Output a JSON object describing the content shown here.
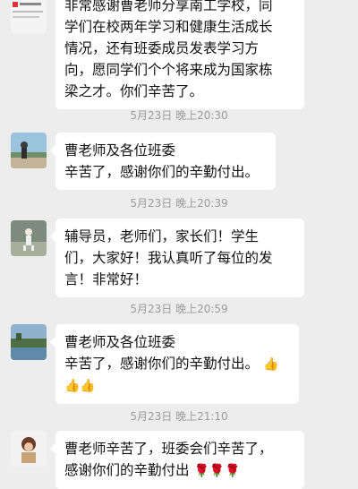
{
  "messages": [
    {
      "lines": [
        "非常感谢曹老师分享南工学校，同",
        "学们在校两年学习和健康生活成长",
        "情况，还有班委成员发表学习方",
        "向，愿同学们个个将来成为国家栋",
        "梁之才。你们辛苦了。"
      ]
    },
    {
      "timestamp": "5月23日 晚上20:30",
      "lines": [
        "曹老师及各位班委",
        "辛苦了，感谢你们的辛勤付出。"
      ]
    },
    {
      "timestamp": "5月23日 晚上20:39",
      "lines": [
        "辅导员，老师们，家长们！学生",
        "们，大家好！我认真听了每位的发",
        "言！非常好！"
      ]
    },
    {
      "timestamp": "5月23日 晚上20:59",
      "lines": [
        "曹老师及各位班委",
        "辛苦了，感谢你们的辛勤付出。"
      ],
      "emoji_after": "👍",
      "emoji_line": "👍👍"
    },
    {
      "timestamp": "5月23日 晚上21:10",
      "lines": [
        "曹老师辛苦了，班委会们辛苦了，",
        "感谢你们的辛勤付出"
      ],
      "emoji_after": "🌹🌹🌹"
    }
  ]
}
